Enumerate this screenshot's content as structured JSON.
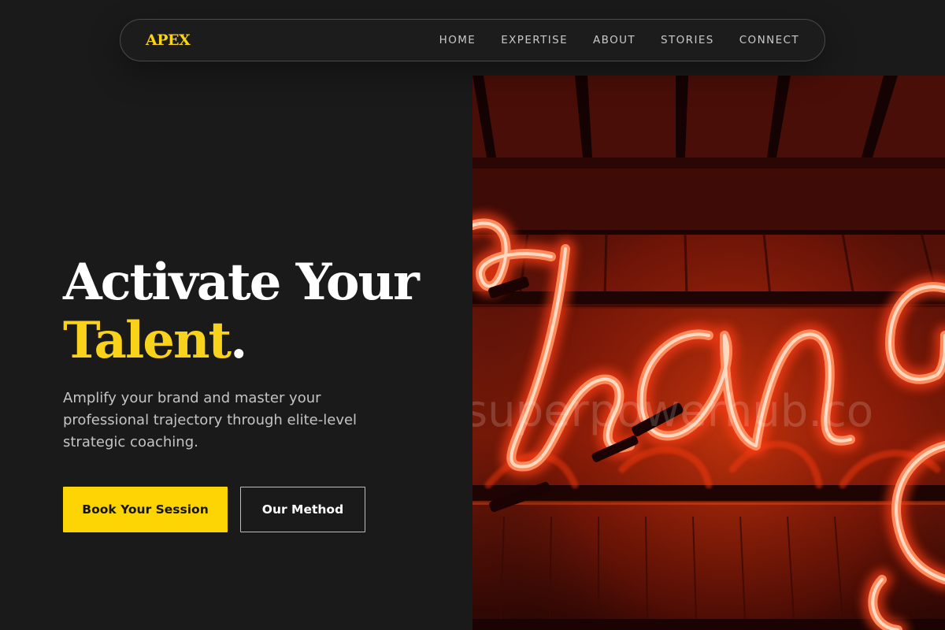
{
  "nav": {
    "logo": "APEX",
    "links": [
      "HOME",
      "EXPERTISE",
      "ABOUT",
      "STORIES",
      "CONNECT"
    ]
  },
  "hero": {
    "headline_line1": "Activate Your",
    "headline_accent": "Talent",
    "headline_period": ".",
    "subtitle": "Amplify your brand and master your professional trajectory through elite-level strategic coaching.",
    "primary_button": "Book Your Session",
    "secondary_button": "Our Method"
  },
  "image": {
    "description_icon": "neon-sign-image",
    "watermark": "superpowerhub.co"
  },
  "colors": {
    "background": "#1a1a1a",
    "accent": "#fdd404",
    "text": "#ffffff",
    "muted": "#c4c4c4",
    "neon": "#ff4a1c"
  }
}
